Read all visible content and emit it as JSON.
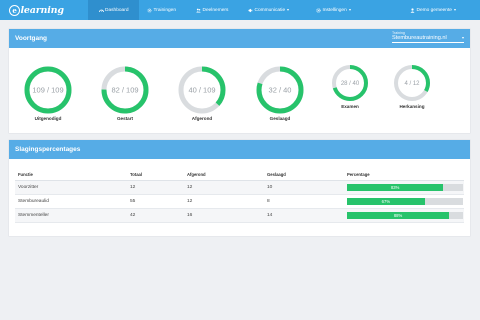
{
  "brand": {
    "logo_letter": "e",
    "logo_text": "learning"
  },
  "nav": {
    "items": [
      {
        "label": "Dashboard",
        "icon": "gauge-icon",
        "active": true
      },
      {
        "label": "Trainingen",
        "icon": "gear-icon",
        "active": false
      },
      {
        "label": "Deelnemers",
        "icon": "users-icon",
        "active": false
      },
      {
        "label": "Communicatie",
        "icon": "megaphone-icon",
        "active": false,
        "dropdown": true
      },
      {
        "label": "Instellingen",
        "icon": "cog-icon",
        "active": false,
        "dropdown": true
      }
    ],
    "user": {
      "label": "Demo gemeente",
      "icon": "user-icon"
    }
  },
  "voortgang": {
    "title": "Voortgang",
    "training_label": "Training",
    "training_value": "Stembureautraining.nl",
    "donuts": [
      {
        "label": "Uitgenodigd",
        "value": "109 / 109",
        "fraction": 1.0
      },
      {
        "label": "Gestart",
        "value": "82 / 109",
        "fraction": 0.752
      },
      {
        "label": "Afgerond",
        "value": "40 / 109",
        "fraction": 0.367
      },
      {
        "label": "Geslaagd",
        "value": "32 / 40",
        "fraction": 0.8
      },
      {
        "label": "Examen",
        "value": "28 / 40",
        "fraction": 0.7
      },
      {
        "label": "Herkansing",
        "value": "4 / 12",
        "fraction": 0.333
      }
    ],
    "colors": {
      "fill": "#27c36b",
      "track": "#d9dcdf"
    }
  },
  "slaging": {
    "title": "Slagingspercentages",
    "headers": [
      "Functie",
      "Totaal",
      "Afgerond",
      "Geslaagd",
      "Percentage"
    ],
    "rows": [
      {
        "functie": "Voorzitter",
        "totaal": "12",
        "afgerond": "12",
        "geslaagd": "10",
        "percentage": "83%",
        "fraction": 0.83
      },
      {
        "functie": "Stembureaulid",
        "totaal": "55",
        "afgerond": "12",
        "geslaagd": "8",
        "percentage": "67%",
        "fraction": 0.67
      },
      {
        "functie": "Stemmenteller",
        "totaal": "42",
        "afgerond": "16",
        "geslaagd": "14",
        "percentage": "88%",
        "fraction": 0.88
      }
    ]
  }
}
